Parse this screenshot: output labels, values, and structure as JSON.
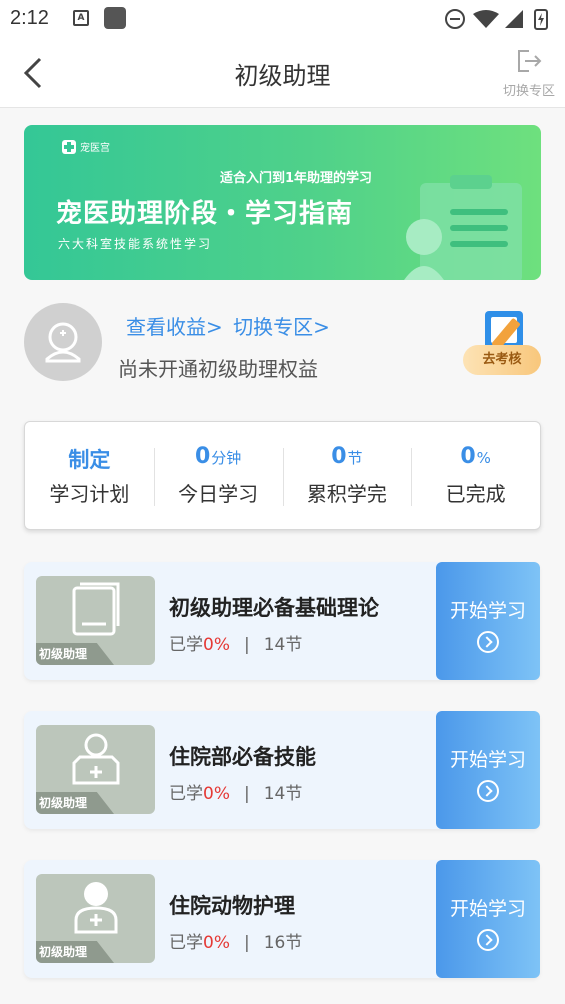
{
  "status_bar": {
    "time": "2:12",
    "notif_icon_letter": "A"
  },
  "header": {
    "title": "初级助理",
    "switch_label": "切换专区"
  },
  "banner": {
    "logo_text": "宠医宫",
    "subtitle": "适合入门到1年助理的学习",
    "main_title": "宠医助理阶段・学习指南",
    "description": "六大科室技能系统性学习"
  },
  "user": {
    "link_earnings": "查看收益>",
    "link_switch": "切换专区>",
    "rights_text": "尚未开通初级助理权益",
    "exam_button": "去考核"
  },
  "stats": [
    {
      "value": "制定",
      "unit": "",
      "label": "学习计划"
    },
    {
      "value": "0",
      "unit": "分钟",
      "label": "今日学习"
    },
    {
      "value": "0",
      "unit": "节",
      "label": "累积学完"
    },
    {
      "value": "0",
      "unit": "%",
      "label": "已完成"
    }
  ],
  "courses": [
    {
      "tag": "初级助理",
      "title": "初级助理必备基础理论",
      "learned_prefix": "已学",
      "learned_pct": "0%",
      "separator": "|",
      "sections": "14节",
      "button": "开始学习",
      "icon": "book-icon"
    },
    {
      "tag": "初级助理",
      "title": "住院部必备技能",
      "learned_prefix": "已学",
      "learned_pct": "0%",
      "separator": "|",
      "sections": "14节",
      "button": "开始学习",
      "icon": "nurse-icon"
    },
    {
      "tag": "初级助理",
      "title": "住院动物护理",
      "learned_prefix": "已学",
      "learned_pct": "0%",
      "separator": "|",
      "sections": "16节",
      "button": "开始学习",
      "icon": "doctor-icon"
    }
  ],
  "colors": {
    "accent_blue": "#3a8ee6",
    "banner_green": "#4fd18a",
    "progress_red": "#e53935"
  }
}
